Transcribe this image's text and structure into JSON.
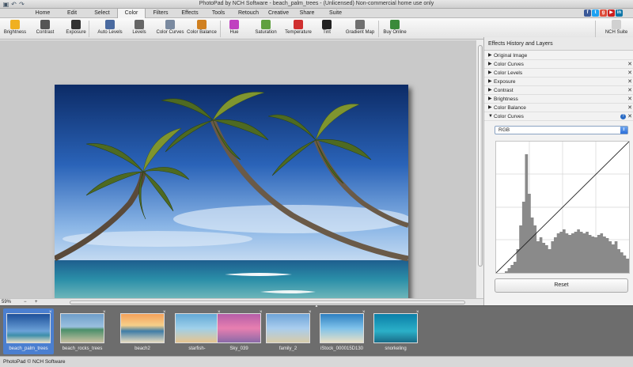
{
  "window": {
    "title": "PhotoPad by NCH Software - beach_palm_trees - (Unlicensed) Non-commercial home use only"
  },
  "quick_access": [
    {
      "name": "save-icon",
      "glyph": "▣"
    },
    {
      "name": "undo-icon",
      "glyph": "↶"
    },
    {
      "name": "redo-icon",
      "glyph": "↷"
    }
  ],
  "social": [
    {
      "name": "facebook-icon",
      "glyph": "f",
      "color": "#3b5998"
    },
    {
      "name": "twitter-icon",
      "glyph": "t",
      "color": "#1da1f2"
    },
    {
      "name": "googleplus-icon",
      "glyph": "g",
      "color": "#dd4b39"
    },
    {
      "name": "youtube-icon",
      "glyph": "▶",
      "color": "#cc2020"
    },
    {
      "name": "linkedin-icon",
      "glyph": "in",
      "color": "#0e76a8"
    }
  ],
  "tabs": [
    "Home",
    "Edit",
    "Select",
    "Color",
    "Filters",
    "Effects",
    "Tools",
    "Retouch",
    "Creative",
    "Share",
    "Suite"
  ],
  "active_tab": "Color",
  "ribbon": [
    {
      "label": "Brightness",
      "icon": "sun-icon",
      "color": "#f0b020"
    },
    {
      "label": "Contrast",
      "icon": "contrast-icon",
      "color": "#555555"
    },
    {
      "label": "Exposure",
      "icon": "exposure-icon",
      "color": "#333333"
    },
    {
      "label": "Auto Levels",
      "icon": "auto-levels-icon",
      "color": "#4a6aa0"
    },
    {
      "label": "Levels",
      "icon": "levels-icon",
      "color": "#666666"
    },
    {
      "label": "Color Curves",
      "icon": "curves-icon",
      "color": "#7a8aa0"
    },
    {
      "label": "Color Balance",
      "icon": "balance-icon",
      "color": "#d08020"
    },
    {
      "label": "Hue",
      "icon": "hue-icon",
      "color": "#c040c0"
    },
    {
      "label": "Saturation",
      "icon": "saturation-icon",
      "color": "#60a040"
    },
    {
      "label": "Temperature",
      "icon": "thermometer-icon",
      "color": "#d03030"
    },
    {
      "label": "Tint",
      "icon": "tint-icon",
      "color": "#222222"
    },
    {
      "label": "Gradient Map",
      "icon": "gradient-map-icon",
      "color": "#707070"
    },
    {
      "label": "Buy Online",
      "icon": "buy-online-icon",
      "color": "#3a8a3a"
    },
    {
      "label": "NCH Suite",
      "icon": "nch-suite-icon",
      "color": "#d0d0d0"
    }
  ],
  "canvas": {
    "zoom": "59%",
    "zoom_minus": "−",
    "zoom_plus": "+"
  },
  "panel": {
    "title": "Effects History and Layers",
    "layers": [
      {
        "label": "Original Image",
        "expanded": false,
        "removable": false
      },
      {
        "label": "Color Curves",
        "expanded": false,
        "removable": true
      },
      {
        "label": "Color Levels",
        "expanded": false,
        "removable": true
      },
      {
        "label": "Exposure",
        "expanded": false,
        "removable": true
      },
      {
        "label": "Contrast",
        "expanded": false,
        "removable": true
      },
      {
        "label": "Brightness",
        "expanded": false,
        "removable": true
      },
      {
        "label": "Color Balance",
        "expanded": false,
        "removable": true
      },
      {
        "label": "Color Curves",
        "expanded": true,
        "removable": true
      }
    ],
    "channel": "RGB",
    "reset_label": "Reset"
  },
  "thumbnails": [
    {
      "label": "beach_palm_trees",
      "active": true
    },
    {
      "label": "beach_rocks_trees",
      "active": false
    },
    {
      "label": "beach2",
      "active": false
    },
    {
      "label": "starfish-",
      "active": false
    },
    {
      "label": "Sky_039",
      "active": false
    },
    {
      "label": "family_2",
      "active": false
    },
    {
      "label": "iStock_000015D130",
      "active": false
    },
    {
      "label": "snorkeling",
      "active": false
    }
  ],
  "status": "PhotoPad © NCH Software"
}
